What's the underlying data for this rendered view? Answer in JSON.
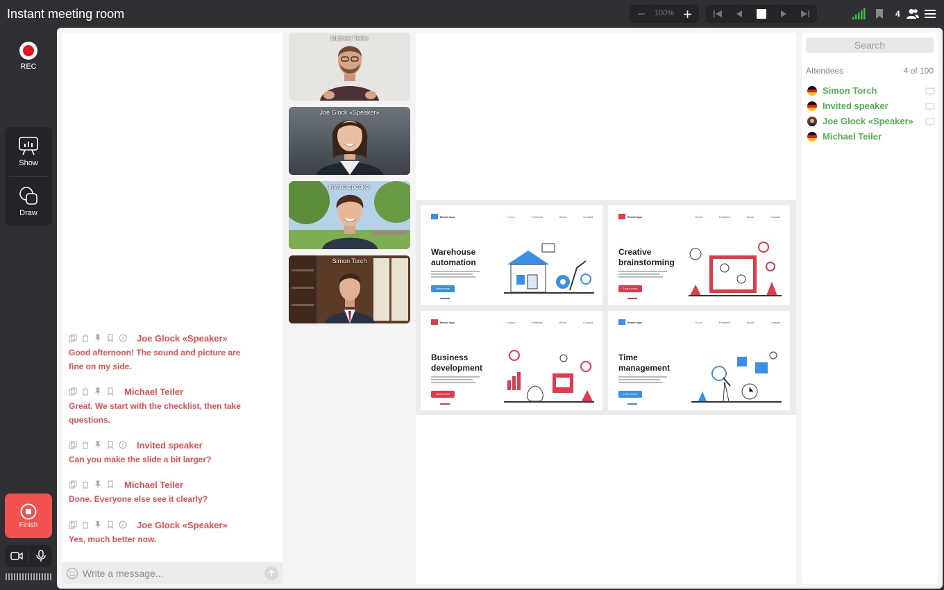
{
  "app": {
    "title": "Instant meeting room"
  },
  "toolbar": {
    "zoom": "100%",
    "participant_count": "4"
  },
  "rail": {
    "rec_label": "REC",
    "show_label": "Show",
    "draw_label": "Draw",
    "finish_label": "Finish"
  },
  "chat": {
    "messages": [
      {
        "author": "Joe Glock «Speaker»",
        "text": "Good afternoon! The sound and picture are fine on my side."
      },
      {
        "author": "Michael Teiler",
        "text": "Great. We start with the checklist, then take questions."
      },
      {
        "author": "Invited speaker",
        "text": "Can you make the slide a bit larger?"
      },
      {
        "author": "Michael Teiler",
        "text": "Done. Everyone else see it clearly?"
      },
      {
        "author": "Joe Glock «Speaker»",
        "text": "Yes, much better now."
      }
    ],
    "placeholder": "Write a message..."
  },
  "videos": [
    {
      "name": "Michael Teiler"
    },
    {
      "name": "Joe Glock «Speaker»"
    },
    {
      "name": "Invited speaker"
    },
    {
      "name": "Simon Torch"
    }
  ],
  "slides": [
    {
      "brand": "Brand logo",
      "nav": [
        "Home",
        "Features",
        "About",
        "Contact"
      ],
      "title": "Warehouse automation",
      "button": "Learn more",
      "accent": "#3a8fe8"
    },
    {
      "brand": "Brand logo",
      "nav": [
        "Home",
        "Features",
        "About",
        "Contact"
      ],
      "title": "Creative brainstorming",
      "button": "Learn more",
      "accent": "#e23a4a"
    },
    {
      "brand": "Brand logo",
      "nav": [
        "Home",
        "Features",
        "About",
        "Contact"
      ],
      "title": "Business development",
      "button": "Learn more",
      "accent": "#e23a4a"
    },
    {
      "brand": "Brand logo",
      "nav": [
        "Home",
        "Features",
        "About",
        "Contact"
      ],
      "title": "Time management",
      "button": "Learn more",
      "accent": "#3a8fe8"
    }
  ],
  "attendees": {
    "search_placeholder": "Search",
    "heading": "Attendees",
    "count": "4 of 100",
    "list": [
      {
        "name": "Simon Torch"
      },
      {
        "name": "Invited speaker"
      },
      {
        "name": "Joe Glock «Speaker»"
      },
      {
        "name": "Michael Teiler"
      }
    ]
  },
  "colors": {
    "chat_text": "#e94f4f",
    "attendee_text": "#52b24c",
    "finish_button": "#f2524f",
    "rec_dot": "#e8141c"
  }
}
